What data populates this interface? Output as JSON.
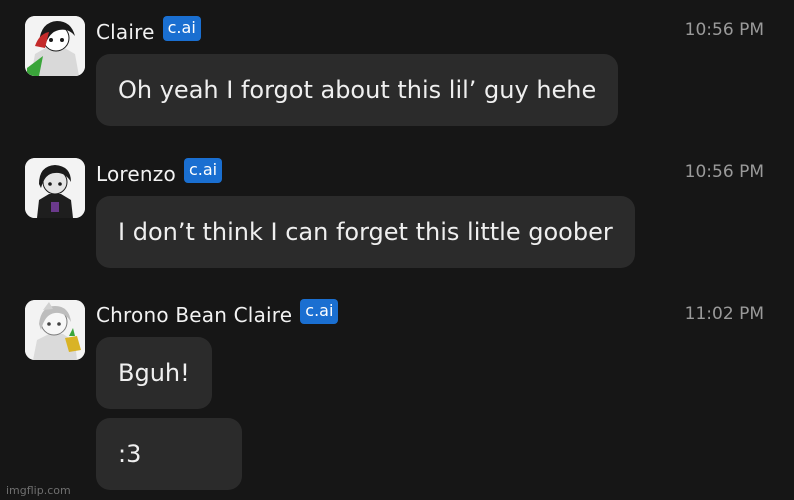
{
  "badge_label": "c.ai",
  "messages": [
    {
      "name": "Claire",
      "time": "10:56 PM",
      "avatar_icon": "claire-character-avatar",
      "bubbles": [
        "Oh yeah I forgot about this lil’ guy hehe"
      ]
    },
    {
      "name": "Lorenzo",
      "time": "10:56 PM",
      "avatar_icon": "lorenzo-character-avatar",
      "bubbles": [
        "I don’t think I can forget this little goober"
      ]
    },
    {
      "name": "Chrono Bean Claire",
      "time": "11:02 PM",
      "avatar_icon": "chrono-bean-claire-character-avatar",
      "bubbles": [
        "Bguh!",
        ":3"
      ]
    }
  ],
  "watermark": "imgflip.com",
  "colors": {
    "background": "#161616",
    "bubble": "#2b2b2b",
    "badge": "#1a6fd1",
    "timestamp": "#9a9a9a"
  }
}
